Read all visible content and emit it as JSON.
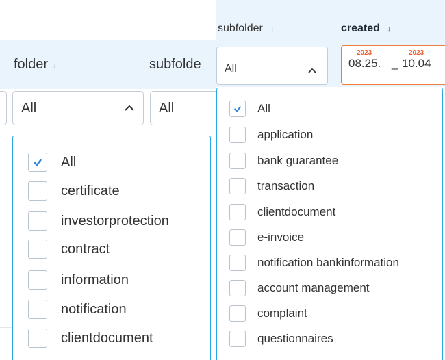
{
  "left": {
    "columns": [
      {
        "title": "folder",
        "sort": "↓",
        "selected": "All"
      },
      {
        "title": "subfolde",
        "sort": "",
        "selected": "All"
      }
    ],
    "dropdown": {
      "options": [
        {
          "label": "All",
          "checked": true
        },
        {
          "label": "certificate",
          "checked": false
        },
        {
          "label": "investorprotection",
          "checked": false
        },
        {
          "label": "contract",
          "checked": false
        },
        {
          "label": "information",
          "checked": false
        },
        {
          "label": "notification",
          "checked": false
        },
        {
          "label": "clientdocument",
          "checked": false
        }
      ]
    }
  },
  "right": {
    "columns": [
      {
        "title": "subfolder",
        "sort": "↓",
        "selected": "All"
      },
      {
        "title": "created",
        "sort": "↓"
      }
    ],
    "date_range": {
      "from_year": "2023",
      "from_date": "08.25.",
      "separator": "_",
      "to_year": "2023",
      "to_date": "10.04"
    },
    "dropdown": {
      "options": [
        {
          "label": "All",
          "checked": true
        },
        {
          "label": "application",
          "checked": false
        },
        {
          "label": "bank guarantee",
          "checked": false
        },
        {
          "label": "transaction",
          "checked": false
        },
        {
          "label": "clientdocument",
          "checked": false
        },
        {
          "label": "e-invoice",
          "checked": false
        },
        {
          "label": "notification bankinformation",
          "checked": false
        },
        {
          "label": "account management",
          "checked": false
        },
        {
          "label": "complaint",
          "checked": false
        },
        {
          "label": "questionnaires",
          "checked": false
        }
      ]
    }
  },
  "colors": {
    "accent": "#29a8e6",
    "check": "#2f86d6",
    "date_accent": "#e8602c",
    "header_bg": "#eaf4fd"
  },
  "icons": {
    "sort": "arrow-down-icon",
    "chevron": "chevron-up-icon",
    "check": "check-icon"
  }
}
